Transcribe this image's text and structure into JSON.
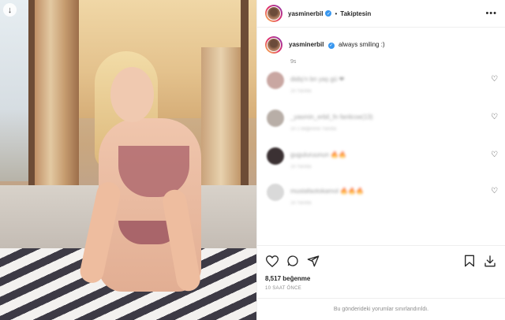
{
  "post": {
    "username": "yasminerbil",
    "follow_label": "Takiptesin",
    "more_label": "•••",
    "download_glyph": "↓",
    "caption": "always smiling :)",
    "caption_time": "9s",
    "likes": "8,517 beğenme",
    "time_ago": "10 SAAT ÖNCE",
    "restricted_text": "Bu gönderideki yorumlar sınırlandırıldı."
  },
  "comments": [
    {
      "text": "didiş'n bn yaş gü ❤",
      "meta": "1h  Yanıtla",
      "avatar_color": "#c9a7a2",
      "heart": "♡"
    },
    {
      "text": "_yasmin_erbil_fn fanlicoe(13)",
      "meta": "1h  1 beğenme  Yanıtla",
      "avatar_color": "#b8aea7",
      "heart": "♡"
    },
    {
      "text": "guguluruunun 🔥🔥",
      "meta": "1h  Yanıtla",
      "avatar_color": "#3b3133",
      "heart": "♡"
    },
    {
      "text": "mustafaotokamol 🔥🔥🔥",
      "meta": "1h  Yanıtla",
      "avatar_color": "#d9d9d9",
      "heart": "♡"
    }
  ],
  "icons": [
    "heart-icon",
    "comment-icon",
    "share-icon",
    "bookmark-icon",
    "download-icon"
  ],
  "colors": {
    "verified": "#3897f0",
    "muted": "#8e8e8e",
    "text": "#262626"
  }
}
